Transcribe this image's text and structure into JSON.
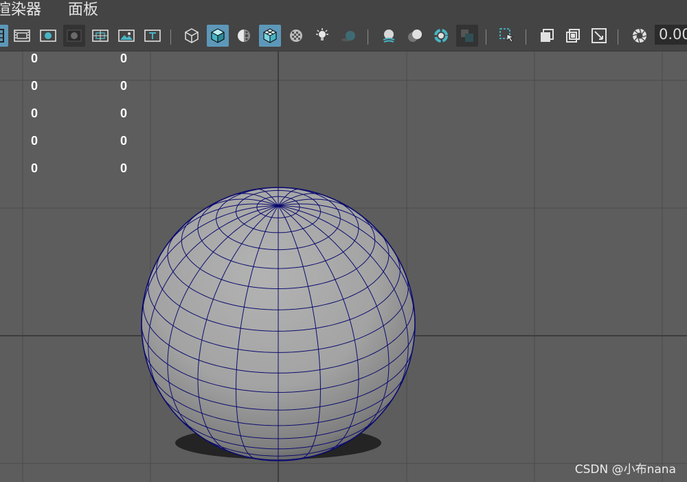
{
  "menubar": {
    "items": [
      {
        "label": "渲染器"
      },
      {
        "label": "面板"
      }
    ]
  },
  "toolbar": {
    "buttons": [
      {
        "icon": "grid-icon",
        "state": "active"
      },
      {
        "icon": "film-gate-icon",
        "state": "normal"
      },
      {
        "icon": "resolution-gate-icon",
        "state": "normal"
      },
      {
        "icon": "gate-mask-icon",
        "state": "pressed"
      },
      {
        "icon": "field-chart-icon",
        "state": "normal"
      },
      {
        "icon": "safe-action-icon",
        "state": "normal"
      },
      {
        "icon": "safe-title-icon",
        "state": "normal"
      },
      {
        "icon": "wireframe-icon",
        "state": "normal"
      },
      {
        "icon": "smooth-shade-icon",
        "state": "active"
      },
      {
        "icon": "default-material-icon",
        "state": "normal"
      },
      {
        "icon": "wireframe-on-shaded-icon",
        "state": "active"
      },
      {
        "icon": "xray-icon",
        "state": "normal"
      },
      {
        "icon": "lighting-icon",
        "state": "normal"
      },
      {
        "icon": "shadows-icon",
        "state": "normal"
      },
      {
        "icon": "screen-space-ao-icon",
        "state": "normal"
      },
      {
        "icon": "motion-blur-icon",
        "state": "normal"
      },
      {
        "icon": "anti-aliasing-icon",
        "state": "normal"
      },
      {
        "icon": "depth-of-field-icon",
        "state": "pressed"
      },
      {
        "icon": "isolate-select-icon",
        "state": "normal"
      },
      {
        "icon": "xray-joints-icon",
        "state": "normal"
      },
      {
        "icon": "xray-active-components-icon",
        "state": "normal"
      },
      {
        "icon": "image-plane-icon",
        "state": "normal"
      },
      {
        "icon": "exposure-icon",
        "state": "normal"
      }
    ],
    "exposure_value": "0.00"
  },
  "hud": {
    "left_column": [
      "0",
      "0",
      "0",
      "0",
      "0"
    ],
    "right_column": [
      "0",
      "0",
      "0",
      "0",
      "0"
    ]
  },
  "colors": {
    "viewport_background": "#5d5d5d",
    "grid_line": "#4a4a4a",
    "grid_axis": "#3c3c3c",
    "wireframe": "#0b0b6e",
    "active_button": "#5d98b9"
  },
  "watermark": "CSDN @小布nana"
}
